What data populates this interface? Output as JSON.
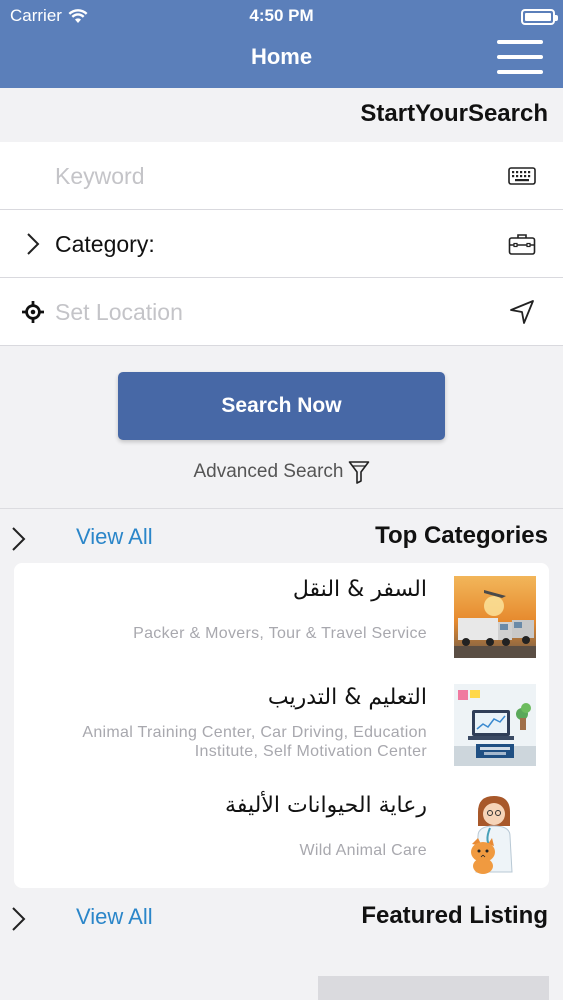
{
  "status_bar": {
    "carrier": "Carrier",
    "time": "4:50 PM"
  },
  "header": {
    "title": "Home",
    "menu_icon": "hamburger-icon"
  },
  "search_section": {
    "title": "StartYourSearch",
    "keyword_placeholder": "Keyword",
    "category_label": "Category:",
    "location_placeholder": "Set Location",
    "search_button": "Search Now",
    "advanced_search": "Advanced Search"
  },
  "top_categories": {
    "title": "Top Categories",
    "view_all": "View All",
    "items": [
      {
        "name": "السفر & النقل",
        "desc": "Packer & Movers, Tour & Travel Service",
        "image": "trucks-image"
      },
      {
        "name": "التعليم & التدريب",
        "desc": "Animal Training Center, Car Driving, Education Institute, Self Motivation Center",
        "image": "education-image"
      },
      {
        "name": "رعاية الحيوانات الأليفة",
        "desc": "Wild Animal Care",
        "image": "vet-cat-image"
      }
    ]
  },
  "featured_listing": {
    "title": "Featured Listing",
    "view_all": "View All"
  },
  "colors": {
    "header": "#5b7fba",
    "button": "#4768a6",
    "link": "#2b86c9"
  }
}
